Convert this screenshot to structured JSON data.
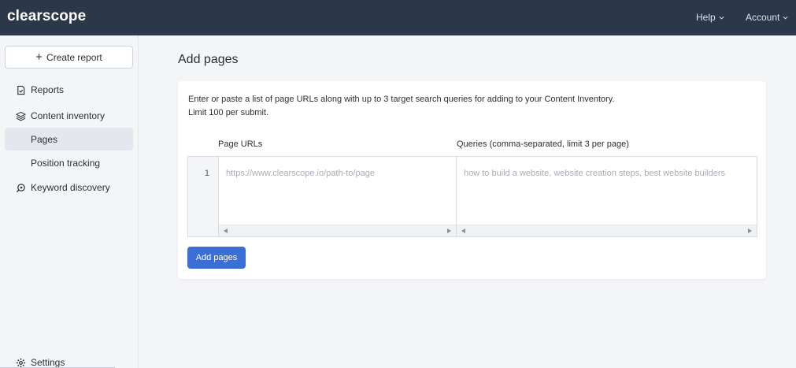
{
  "app": {
    "logo": "clearscope"
  },
  "topnav": {
    "help": "Help",
    "account": "Account"
  },
  "sidebar": {
    "create_report": "Create report",
    "reports": "Reports",
    "content_inventory": "Content inventory",
    "pages": "Pages",
    "position_tracking": "Position tracking",
    "keyword_discovery": "Keyword discovery",
    "settings": "Settings"
  },
  "main": {
    "title": "Add pages",
    "intro_line1": "Enter or paste a list of page URLs along with up to 3 target search queries for adding to your Content Inventory.",
    "intro_line2": "Limit 100 per submit.",
    "col_urls": "Page URLs",
    "col_queries": "Queries (comma-separated, limit 3 per page)",
    "line_number": "1",
    "url_placeholder": "https://www.clearscope.io/path-to/page",
    "queries_placeholder": "how to build a website, website creation steps, best website builders",
    "add_button": "Add pages"
  },
  "icons": {
    "reports": "document-check-icon",
    "content_inventory": "layers-icon",
    "keyword_discovery": "discovery-icon",
    "settings": "gear-icon"
  },
  "colors": {
    "topbar": "#2c3749",
    "primary": "#3b6fd6",
    "active_nav": "#e4e8ee"
  }
}
